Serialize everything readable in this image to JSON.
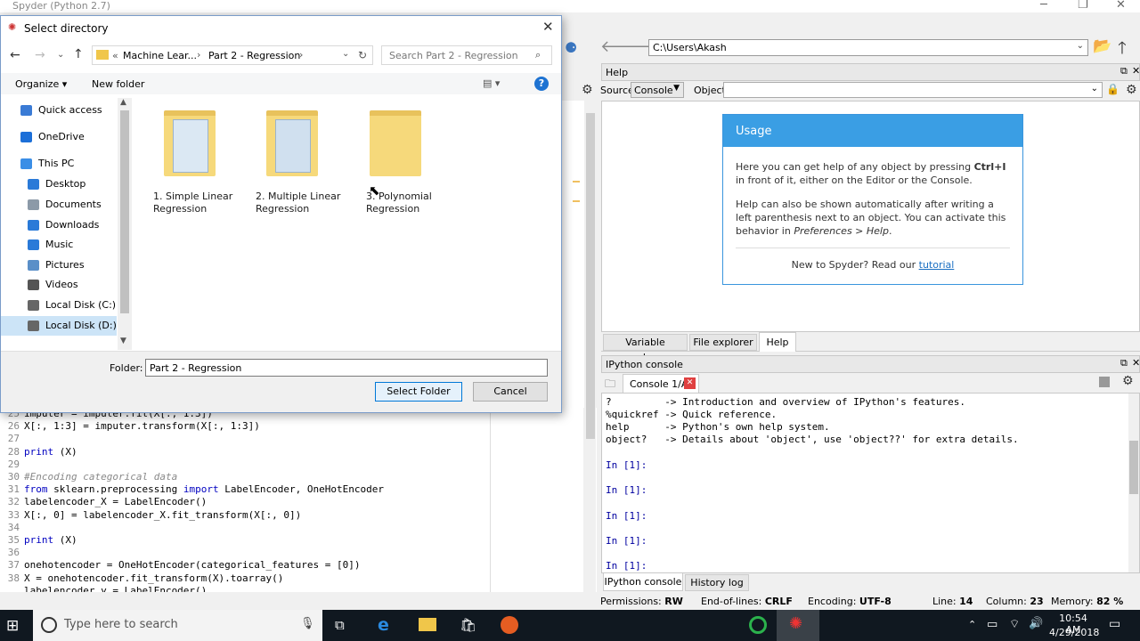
{
  "app_title": "Spyder (Python 2.7)",
  "path_input": "C:\\Users\\Akash",
  "help_pane": {
    "title": "Help",
    "source_label": "Source",
    "source_value": "Console",
    "object_label": "Object",
    "usage_title": "Usage",
    "usage_p1a": "Here you can get help of any object by pressing ",
    "usage_p1b": "Ctrl+I",
    "usage_p1c": " in front of it, either on the Editor or the Console.",
    "usage_p2a": "Help can also be shown automatically after writing a left parenthesis next to an object. You can activate this behavior in ",
    "usage_p2b": "Preferences > Help",
    "usage_p2c": ".",
    "new_text": "New to Spyder? Read our ",
    "tutorial_link": "tutorial",
    "tabs": [
      "Variable explorer",
      "File explorer",
      "Help"
    ]
  },
  "console_pane": {
    "title": "IPython console",
    "tab_label": "Console 1/A",
    "lines": [
      {
        "a": "?",
        "b": "         -> Introduction and overview of IPython's features."
      },
      {
        "a": "%quickref",
        "b": " -> Quick reference."
      },
      {
        "a": "help",
        "b": "      -> Python's own help system."
      },
      {
        "a": "object?",
        "b": "   -> Details about 'object', use 'object??' for extra details."
      }
    ],
    "prompts": [
      "In [1]:",
      "In [1]:",
      "In [1]:",
      "In [1]:",
      "In [1]:"
    ],
    "tabs": [
      "IPython console",
      "History log"
    ]
  },
  "editor": {
    "lines": [
      {
        "n": "25",
        "t": "imputer = imputer.fit(X[:, 1:3])",
        "k": "code"
      },
      {
        "n": "26",
        "t": "X[:, 1:3] = imputer.transform(X[:, 1:3])",
        "k": "code"
      },
      {
        "n": "27",
        "t": "",
        "k": "code"
      },
      {
        "n": "28",
        "t": "print (X)",
        "k": "print"
      },
      {
        "n": "29",
        "t": "",
        "k": "code"
      },
      {
        "n": "30",
        "t": "#Encoding categorical data",
        "k": "comment"
      },
      {
        "n": "31",
        "t": "from sklearn.preprocessing import LabelEncoder, OneHotEncoder",
        "k": "import"
      },
      {
        "n": "32",
        "t": "labelencoder_X = LabelEncoder()",
        "k": "code"
      },
      {
        "n": "33",
        "t": "X[:, 0] = labelencoder_X.fit_transform(X[:, 0])",
        "k": "code"
      },
      {
        "n": "34",
        "t": "",
        "k": "code"
      },
      {
        "n": "35",
        "t": "print (X)",
        "k": "print"
      },
      {
        "n": "36",
        "t": "",
        "k": "code"
      },
      {
        "n": "37",
        "t": "onehotencoder = OneHotEncoder(categorical_features = [0])",
        "k": "code"
      },
      {
        "n": "38",
        "t": "X = onehotencoder.fit_transform(X).toarray()",
        "k": "code"
      },
      {
        "n": "",
        "t": "labelencoder_y = LabelEncoder()",
        "k": "code"
      }
    ]
  },
  "statusbar": {
    "permissions_label": "Permissions:",
    "permissions": "RW",
    "eol_label": "End-of-lines:",
    "eol": "CRLF",
    "encoding_label": "Encoding:",
    "encoding": "UTF-8",
    "line_label": "Line:",
    "line": "14",
    "column_label": "Column:",
    "column": "23",
    "memory_label": "Memory:",
    "memory": "82 %"
  },
  "dialog": {
    "title": "Select directory",
    "breadcrumb_prefix": "«",
    "breadcrumb": [
      "Machine Lear...",
      "Part 2 - Regression"
    ],
    "search_placeholder": "Search Part 2 - Regression",
    "organize": "Organize",
    "new_folder": "New folder",
    "nav": [
      {
        "label": "Quick access",
        "icon": "star-icon",
        "color": "#3a7bd5"
      },
      {
        "label": "OneDrive",
        "icon": "cloud-icon",
        "color": "#1c6fd8"
      },
      {
        "label": "This PC",
        "icon": "pc-icon",
        "color": "#3a8ee6"
      },
      {
        "label": "Desktop",
        "icon": "desktop-icon",
        "color": "#2a7ad8"
      },
      {
        "label": "Documents",
        "icon": "documents-icon",
        "color": "#8c9aa8"
      },
      {
        "label": "Downloads",
        "icon": "download-icon",
        "color": "#2a7ad8"
      },
      {
        "label": "Music",
        "icon": "music-icon",
        "color": "#2a7ad8"
      },
      {
        "label": "Pictures",
        "icon": "pictures-icon",
        "color": "#5a8fc8"
      },
      {
        "label": "Videos",
        "icon": "videos-icon",
        "color": "#555"
      },
      {
        "label": "Local Disk (C:)",
        "icon": "drive-icon",
        "color": "#666"
      },
      {
        "label": "Local Disk (D:)",
        "icon": "drive-icon",
        "color": "#666"
      }
    ],
    "folders": [
      {
        "label": "1. Simple Linear Regression"
      },
      {
        "label": "2. Multiple Linear Regression"
      },
      {
        "label": "3. Polynomial Regression"
      }
    ],
    "folder_label": "Folder:",
    "folder_value": "Part 2 - Regression",
    "select_button": "Select Folder",
    "cancel_button": "Cancel"
  },
  "taskbar": {
    "search_placeholder": "Type here to search",
    "time": "10:54 AM",
    "date": "4/29/2018"
  }
}
